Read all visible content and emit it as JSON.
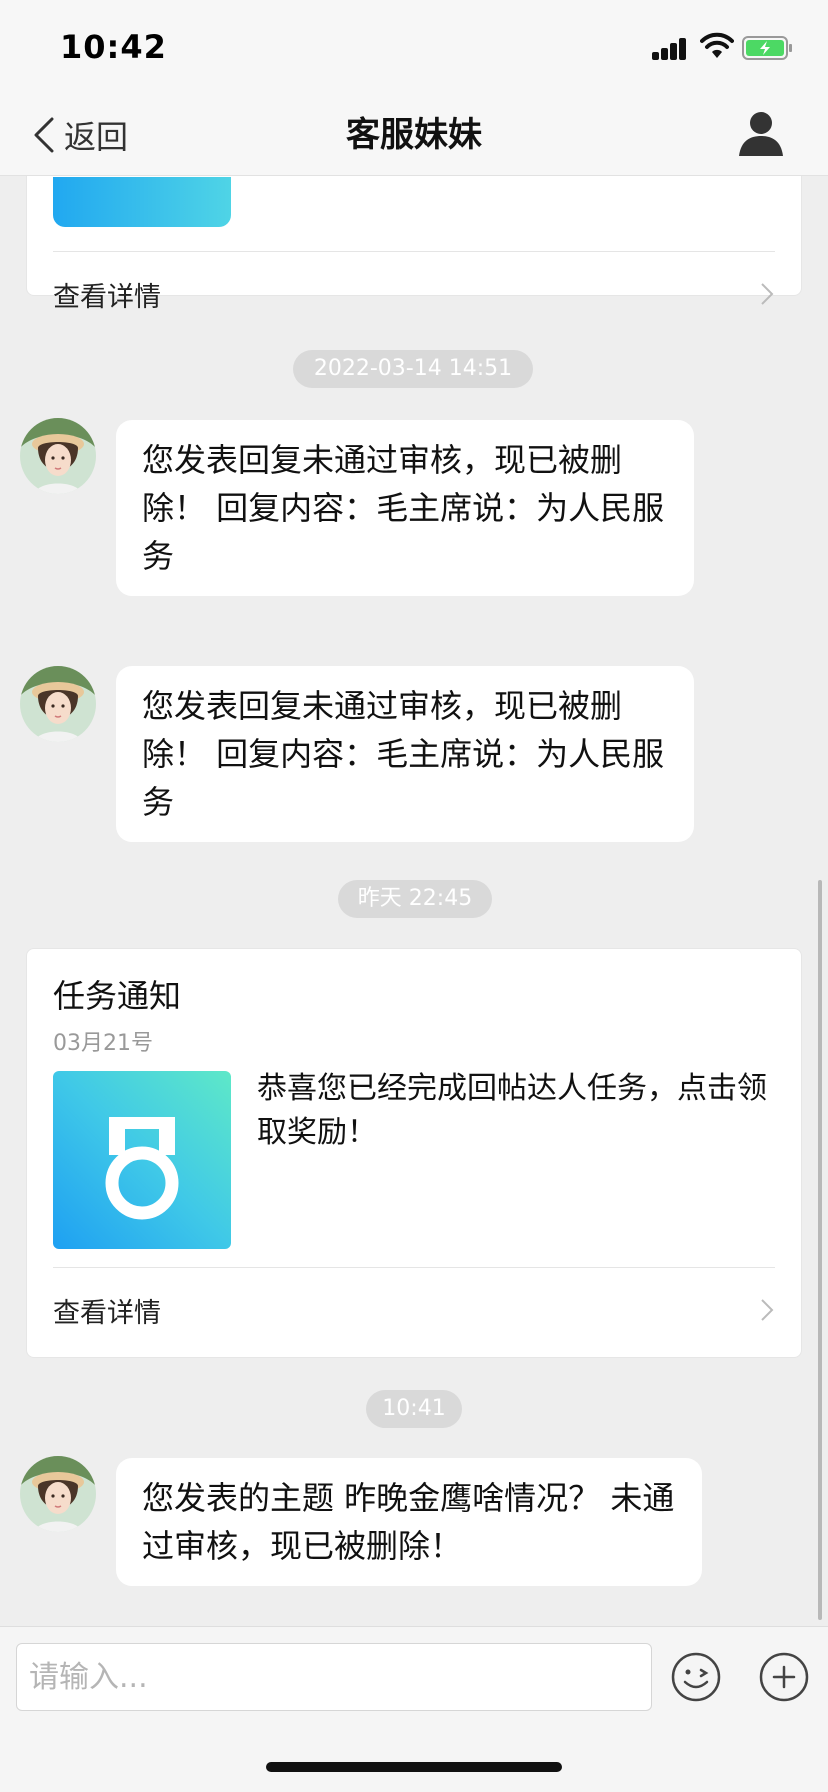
{
  "status_bar": {
    "time": "10:42"
  },
  "nav": {
    "back_label": "返回",
    "title": "客服妹妹"
  },
  "top_card": {
    "detail_label": "查看详情"
  },
  "timestamps": {
    "t1": "2022-03-14 14:51",
    "t2": "昨天 22:45",
    "t3": "10:41"
  },
  "messages": [
    {
      "text": "您发表回复未通过审核，现已被删除！ 回复内容：毛主席说：为人民服务"
    },
    {
      "text": "您发表回复未通过审核，现已被删除！ 回复内容：毛主席说：为人民服务"
    },
    {
      "text": "您发表的主题 昨晚金鹰啥情况？ 未通过审核，现已被删除！"
    }
  ],
  "task_card": {
    "title": "任务通知",
    "date": "03月21号",
    "body": "恭喜您已经完成回帖达人任务，点击领取奖励！",
    "detail_label": "查看详情"
  },
  "input": {
    "placeholder": "请输入..."
  },
  "colors": {
    "background": "#eeeeee",
    "bubble": "#ffffff",
    "timestamp_pill": "#d9d9d9",
    "battery_green": "#4cd964"
  },
  "icons": [
    "back-chevron-icon",
    "user-profile-icon",
    "signal-icon",
    "wifi-icon",
    "battery-icon",
    "chevron-right-icon",
    "medal-icon",
    "emoji-icon",
    "plus-icon"
  ]
}
